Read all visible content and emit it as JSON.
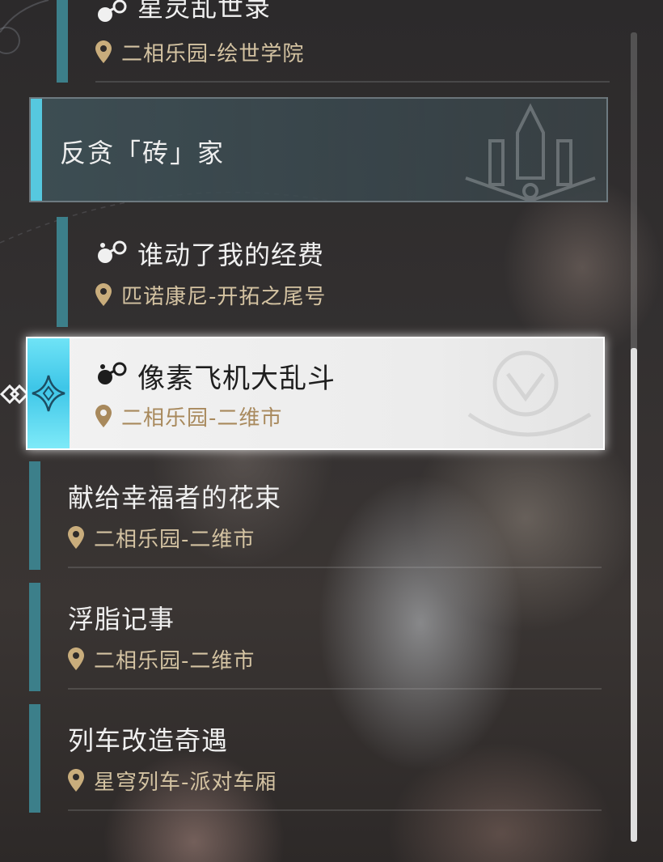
{
  "quests_top": {
    "partial": {
      "title": "星灵乱世录",
      "location": "二相乐园-绘世学院"
    }
  },
  "section": {
    "title": "反贪「砖」家"
  },
  "quests": [
    {
      "title": "谁动了我的经费",
      "location": "匹诺康尼-开拓之尾号",
      "has_icon": true
    },
    {
      "title": "像素飞机大乱斗",
      "location": "二相乐园-二维市",
      "has_icon": true,
      "selected": true
    },
    {
      "title": "献给幸福者的花束",
      "location": "二相乐园-二维市",
      "has_icon": false
    },
    {
      "title": "浮脂记事",
      "location": "二相乐园-二维市",
      "has_icon": false
    },
    {
      "title": "列车改造奇遇",
      "location": "星穹列车-派对车厢",
      "has_icon": false
    }
  ],
  "colors": {
    "accent": "#56c8df",
    "item_bar": "#3c7f8a",
    "location_text": "#d4c3a2",
    "selected_bg": "#f0f0f0"
  },
  "icons": {
    "quest_type": "molecule-icon",
    "location": "map-pin-icon",
    "selection": "diamond-arrow-icon"
  }
}
